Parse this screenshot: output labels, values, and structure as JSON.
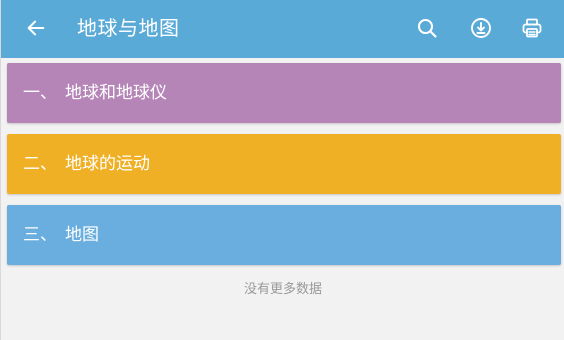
{
  "header": {
    "title": "地球与地图",
    "background": "#5aaad8",
    "back_icon": "arrow-left-icon",
    "actions": [
      {
        "name": "search",
        "icon": "search-icon"
      },
      {
        "name": "download",
        "icon": "download-icon"
      },
      {
        "name": "print",
        "icon": "print-icon"
      }
    ]
  },
  "chapters": [
    {
      "number": "一、",
      "title": "地球和地球仪",
      "color": "#b585b8"
    },
    {
      "number": "二、",
      "title": "地球的运动",
      "color": "#f0b025"
    },
    {
      "number": "三、",
      "title": "地图",
      "color": "#69aedf"
    }
  ],
  "footer": {
    "text": "没有更多数据"
  }
}
